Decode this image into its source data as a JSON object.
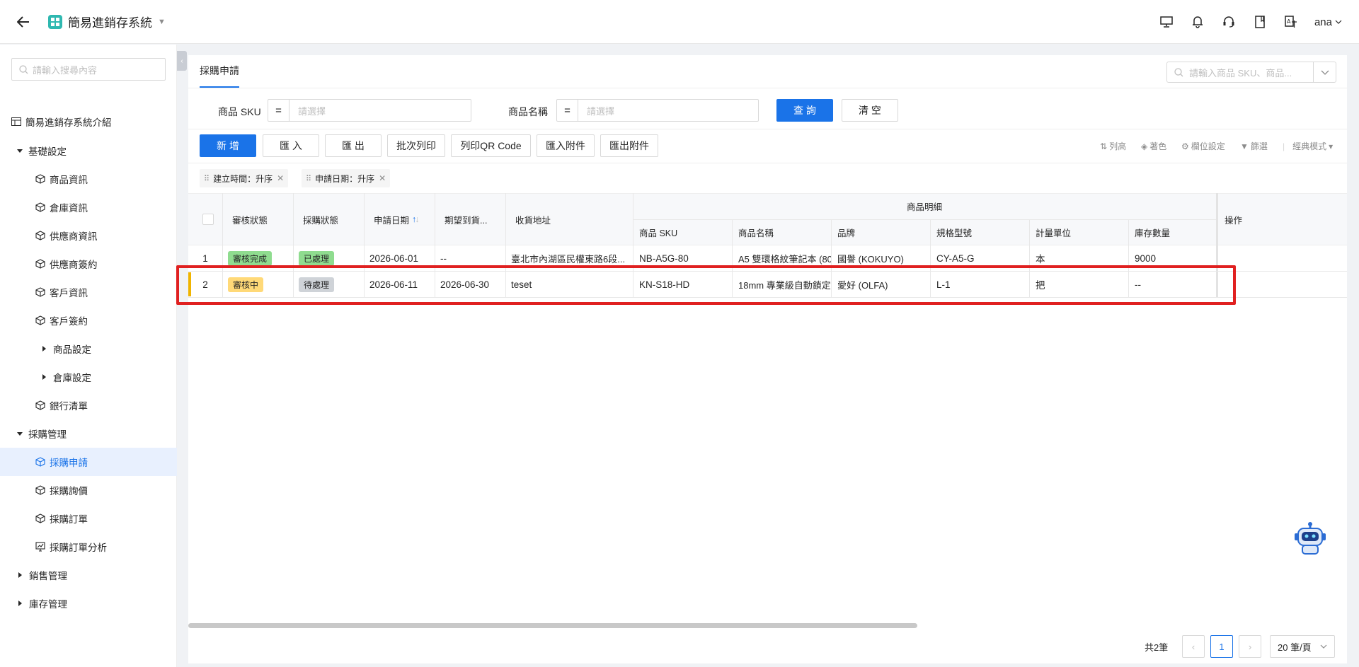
{
  "app": {
    "title": "簡易進銷存系統",
    "user": "ana"
  },
  "top_icons": [
    "monitor-icon",
    "bell-icon",
    "headset-icon",
    "bookmark-icon",
    "translate-icon"
  ],
  "sidebar": {
    "search_placeholder": "請輸入搜尋內容",
    "items": [
      {
        "label": "簡易進銷存系統介紹"
      },
      {
        "label": "基礎設定"
      },
      {
        "label": "商品資訊"
      },
      {
        "label": "倉庫資訊"
      },
      {
        "label": "供應商資訊"
      },
      {
        "label": "供應商簽約"
      },
      {
        "label": "客戶資訊"
      },
      {
        "label": "客戶簽約"
      },
      {
        "label": "商品設定"
      },
      {
        "label": "倉庫設定"
      },
      {
        "label": "銀行清單"
      },
      {
        "label": "採購管理"
      },
      {
        "label": "採購申請"
      },
      {
        "label": "採購詢價"
      },
      {
        "label": "採購訂單"
      },
      {
        "label": "採購訂單分析"
      },
      {
        "label": "銷售管理"
      },
      {
        "label": "庫存管理"
      }
    ]
  },
  "main": {
    "tab": "採購申請",
    "top_search_placeholder": "請輸入商品 SKU、商品...",
    "filters": {
      "sku_label": "商品 SKU",
      "name_label": "商品名稱",
      "op": "=",
      "placeholder": "請選擇",
      "query": "查 詢",
      "clear": "清 空"
    },
    "toolbar": {
      "add": "新 增",
      "import": "匯 入",
      "export": "匯 出",
      "batch_print": "批次列印",
      "print_qr": "列印QR Code",
      "import_attach": "匯入附件",
      "export_attach": "匯出附件",
      "row_height": "列高",
      "color": "著色",
      "column_settings": "欄位設定",
      "filter": "篩選",
      "classic_mode": "經典模式"
    },
    "sort_chips": [
      "建立時間：升序",
      "申請日期：升序"
    ],
    "table": {
      "headers": {
        "review_status": "審核狀態",
        "purchase_status": "採購狀態",
        "apply_date": "申請日期",
        "expected_date": "期望到貨...",
        "address": "收貨地址",
        "group": "商品明細",
        "sku": "商品 SKU",
        "name": "商品名稱",
        "brand": "品牌",
        "spec": "規格型號",
        "unit": "計量單位",
        "stock": "庫存數量",
        "ops": "操作"
      },
      "rows": [
        {
          "no": "1",
          "review": "審核完成",
          "purchase": "已處理",
          "apply_date": "2026-06-01",
          "expected": "--",
          "address": "臺北市內湖區民權東路6段...",
          "sku": "NB-A5G-80",
          "name": "A5 雙環格紋筆記本 (80",
          "brand": "國譽 (KOKUYO)",
          "spec": "CY-A5-G",
          "unit": "本",
          "stock": "9000"
        },
        {
          "no": "2",
          "review": "審核中",
          "purchase": "待處理",
          "apply_date": "2026-06-11",
          "expected": "2026-06-30",
          "address": "teset",
          "sku": "KN-S18-HD",
          "name": "18mm 專業級自動鎖定",
          "brand": "愛好 (OLFA)",
          "spec": "L-1",
          "unit": "把",
          "stock": "--"
        }
      ]
    },
    "pager": {
      "total": "共2筆",
      "page": "1",
      "size": "20 筆/頁"
    }
  },
  "colors": {
    "primary": "#1a73e8",
    "tag_green_bg": "#8fdc8f",
    "tag_yellow_bg": "#ffd978",
    "tag_gray_bg": "#cfd3d8",
    "highlight": "#e02020"
  }
}
